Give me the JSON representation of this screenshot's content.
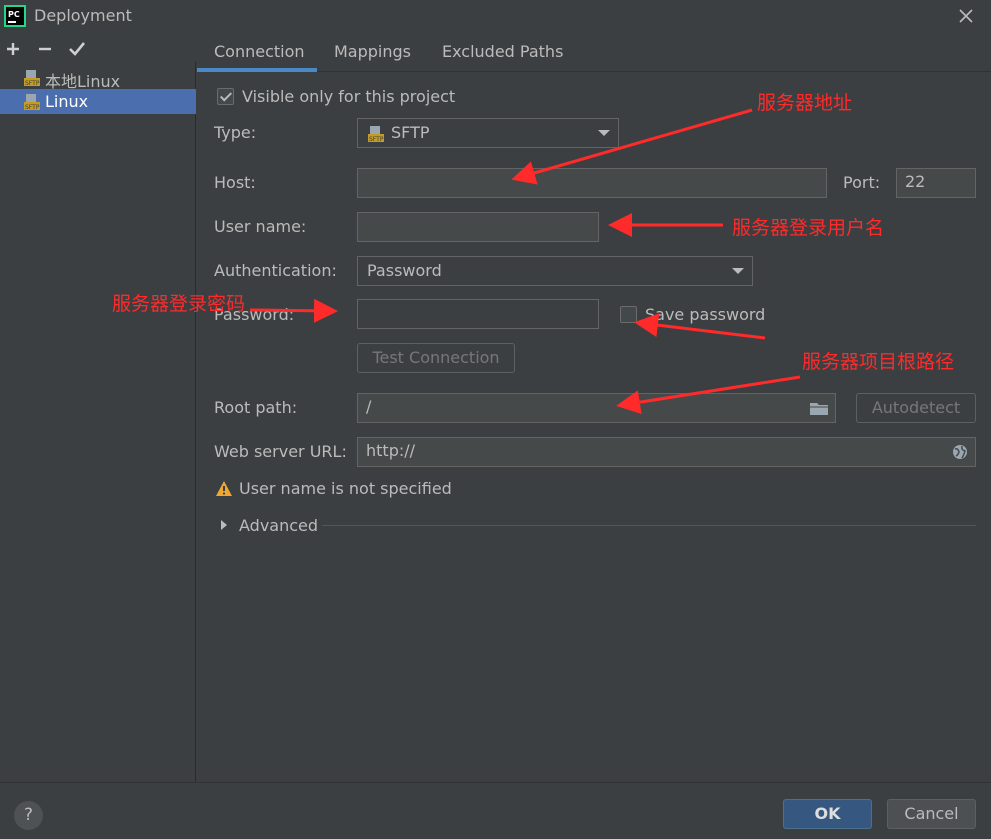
{
  "window": {
    "title": "Deployment"
  },
  "toolbar": {
    "add": "+",
    "remove": "−",
    "apply": "✔"
  },
  "servers": [
    {
      "label": "本地Linux",
      "icon": "sftp-server-icon",
      "selected": false
    },
    {
      "label": "Linux",
      "icon": "sftp-server-icon",
      "selected": true
    }
  ],
  "tabs": [
    {
      "label": "Connection",
      "active": true
    },
    {
      "label": "Mappings",
      "active": false
    },
    {
      "label": "Excluded Paths",
      "active": false
    }
  ],
  "form": {
    "visible_only": {
      "label": "Visible only for this project",
      "checked": true
    },
    "type": {
      "label": "Type:",
      "value": "SFTP"
    },
    "host": {
      "label": "Host:",
      "value": ""
    },
    "port": {
      "label": "Port:",
      "value": "22"
    },
    "username": {
      "label": "User name:",
      "value": ""
    },
    "authentication": {
      "label": "Authentication:",
      "value": "Password"
    },
    "password": {
      "label": "Password:",
      "value": ""
    },
    "save_password": {
      "label": "Save password",
      "checked": false
    },
    "test_connection": "Test Connection",
    "root_path": {
      "label": "Root path:",
      "value": "/"
    },
    "autodetect": "Autodetect",
    "web_url": {
      "label": "Web server URL:",
      "value": "http://"
    },
    "warning": "User name is not specified",
    "advanced": "Advanced"
  },
  "annotations": {
    "server_address": "服务器地址",
    "login_user": "服务器登录用户名",
    "login_password": "服务器登录密码",
    "root_path": "服务器项目根路径"
  },
  "footer": {
    "help": "?",
    "ok": "OK",
    "cancel": "Cancel"
  },
  "colors": {
    "background": "#3c3f41",
    "selection": "#4b6eaf",
    "accent": "#4a88c7",
    "annotation": "#ff2a2a",
    "ok_button": "#365880"
  }
}
